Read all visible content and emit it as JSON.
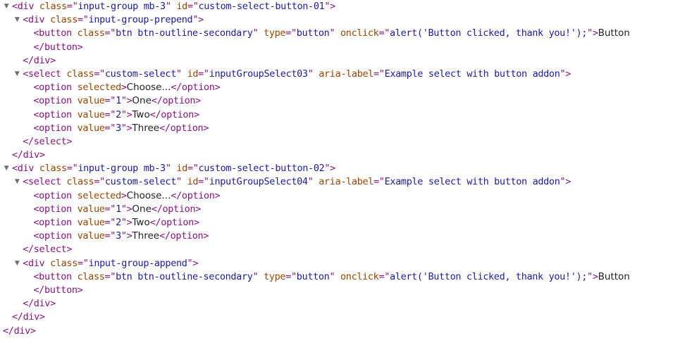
{
  "elements_tree": {
    "nodes": [
      {
        "depth": 0,
        "expandable": true,
        "kind": "open",
        "tag": "div",
        "attrs": [
          {
            "name": "class",
            "value": "input-group mb-3"
          },
          {
            "name": "id",
            "value": "custom-select-button-01"
          }
        ]
      },
      {
        "depth": 1,
        "expandable": true,
        "kind": "open",
        "tag": "div",
        "attrs": [
          {
            "name": "class",
            "value": "input-group-prepend"
          }
        ]
      },
      {
        "depth": 2,
        "expandable": false,
        "kind": "open",
        "tag": "button",
        "attrs": [
          {
            "name": "class",
            "value": "btn btn-outline-secondary"
          },
          {
            "name": "type",
            "value": "button"
          },
          {
            "name": "onclick",
            "value": "alert('Button clicked, thank you!');"
          }
        ],
        "text": "Button"
      },
      {
        "depth": 2,
        "expandable": false,
        "kind": "close",
        "tag": "button"
      },
      {
        "depth": 1,
        "expandable": false,
        "kind": "close",
        "tag": "div"
      },
      {
        "depth": 1,
        "expandable": true,
        "kind": "open",
        "tag": "select",
        "attrs": [
          {
            "name": "class",
            "value": "custom-select"
          },
          {
            "name": "id",
            "value": "inputGroupSelect03"
          },
          {
            "name": "aria-label",
            "value": "Example select with button addon"
          }
        ]
      },
      {
        "depth": 2,
        "expandable": false,
        "kind": "inline",
        "tag": "option",
        "attrs": [
          {
            "name": "selected"
          }
        ],
        "text": "Choose..."
      },
      {
        "depth": 2,
        "expandable": false,
        "kind": "inline",
        "tag": "option",
        "attrs": [
          {
            "name": "value",
            "value": "1"
          }
        ],
        "text": "One"
      },
      {
        "depth": 2,
        "expandable": false,
        "kind": "inline",
        "tag": "option",
        "attrs": [
          {
            "name": "value",
            "value": "2"
          }
        ],
        "text": "Two"
      },
      {
        "depth": 2,
        "expandable": false,
        "kind": "inline",
        "tag": "option",
        "attrs": [
          {
            "name": "value",
            "value": "3"
          }
        ],
        "text": "Three"
      },
      {
        "depth": 1,
        "expandable": false,
        "kind": "close",
        "tag": "select"
      },
      {
        "depth": 0,
        "expandable": false,
        "kind": "close",
        "tag": "div"
      },
      {
        "depth": 0,
        "expandable": true,
        "kind": "open",
        "tag": "div",
        "attrs": [
          {
            "name": "class",
            "value": "input-group mb-3"
          },
          {
            "name": "id",
            "value": "custom-select-button-02"
          }
        ]
      },
      {
        "depth": 1,
        "expandable": true,
        "kind": "open",
        "tag": "select",
        "attrs": [
          {
            "name": "class",
            "value": "custom-select"
          },
          {
            "name": "id",
            "value": "inputGroupSelect04"
          },
          {
            "name": "aria-label",
            "value": "Example select with button addon"
          }
        ]
      },
      {
        "depth": 2,
        "expandable": false,
        "kind": "inline",
        "tag": "option",
        "attrs": [
          {
            "name": "selected"
          }
        ],
        "text": "Choose..."
      },
      {
        "depth": 2,
        "expandable": false,
        "kind": "inline",
        "tag": "option",
        "attrs": [
          {
            "name": "value",
            "value": "1"
          }
        ],
        "text": "One"
      },
      {
        "depth": 2,
        "expandable": false,
        "kind": "inline",
        "tag": "option",
        "attrs": [
          {
            "name": "value",
            "value": "2"
          }
        ],
        "text": "Two"
      },
      {
        "depth": 2,
        "expandable": false,
        "kind": "inline",
        "tag": "option",
        "attrs": [
          {
            "name": "value",
            "value": "3"
          }
        ],
        "text": "Three"
      },
      {
        "depth": 1,
        "expandable": false,
        "kind": "close",
        "tag": "select"
      },
      {
        "depth": 1,
        "expandable": true,
        "kind": "open",
        "tag": "div",
        "attrs": [
          {
            "name": "class",
            "value": "input-group-append"
          }
        ]
      },
      {
        "depth": 2,
        "expandable": false,
        "kind": "open",
        "tag": "button",
        "attrs": [
          {
            "name": "class",
            "value": "btn btn-outline-secondary"
          },
          {
            "name": "type",
            "value": "button"
          },
          {
            "name": "onclick",
            "value": "alert('Button clicked, thank you!');"
          }
        ],
        "text": "Button"
      },
      {
        "depth": 2,
        "expandable": false,
        "kind": "close",
        "tag": "button"
      },
      {
        "depth": 1,
        "expandable": false,
        "kind": "close",
        "tag": "div"
      },
      {
        "depth": 0,
        "expandable": false,
        "kind": "close",
        "tag": "div"
      },
      {
        "depth": -1,
        "expandable": false,
        "kind": "close",
        "tag": "div"
      }
    ]
  },
  "colors": {
    "tag": "#881280",
    "attribute_name": "#994500",
    "attribute_value": "#1a1aa6",
    "text_node": "#222222",
    "expand_triangle": "#6e6e6e",
    "background": "#ffffff"
  },
  "icons": {
    "expanded": "triangle-down-icon"
  }
}
